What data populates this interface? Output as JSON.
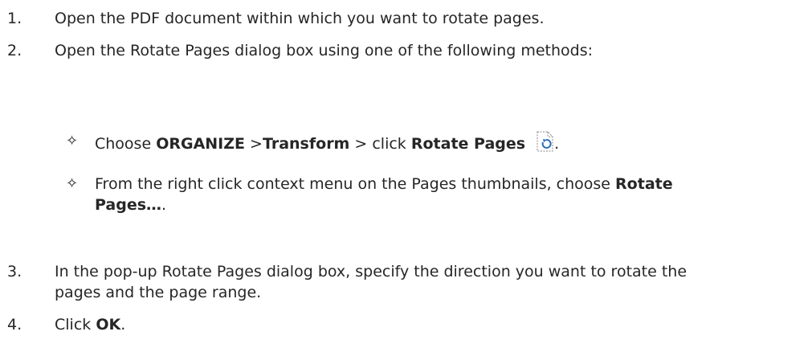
{
  "steps": [
    {
      "num": "1.",
      "text": "Open the PDF document within which you want to rotate pages."
    },
    {
      "num": "2.",
      "text": "Open the Rotate Pages dialog box using one of the following methods:"
    },
    {
      "num": "3.",
      "line1": "In the pop-up Rotate Pages dialog box, specify the direction you want to rotate the",
      "line2": "pages and the page range."
    },
    {
      "num": "4.",
      "pre": "Click ",
      "bold": "OK",
      "post": "."
    }
  ],
  "methods": {
    "bullet_glyph": "✧",
    "m1": {
      "pre": "Choose ",
      "b1": "ORGANIZE",
      "t1": " >",
      "b2": "Transform",
      "t2": " > click ",
      "b3": "Rotate Pages",
      "icon": "rotate-pages-icon",
      "post": "."
    },
    "m2": {
      "line1": "From the right click context menu on the Pages thumbnails, choose ",
      "b1": "Rotate",
      "b2": "Pages…",
      "post": "."
    }
  }
}
